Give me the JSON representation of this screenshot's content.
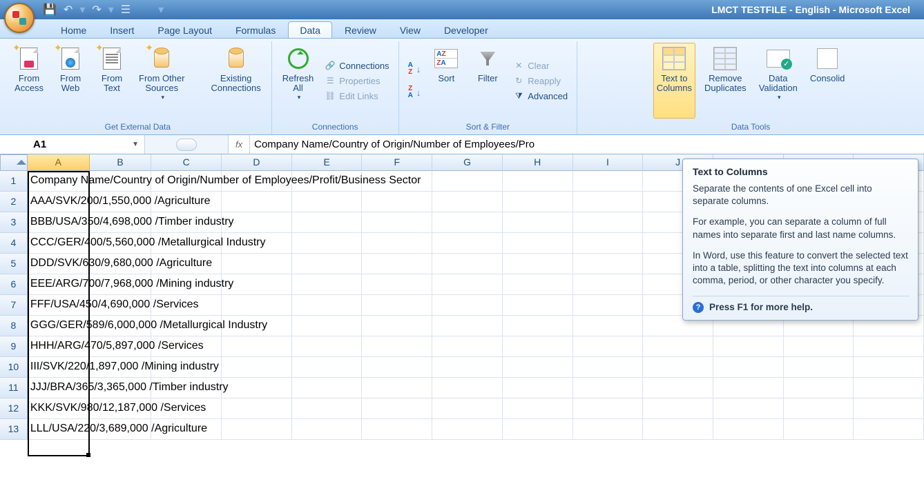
{
  "app_title": "LMCT TESTFILE - English - Microsoft Excel",
  "qat": {
    "save": "💾",
    "undo": "↶",
    "redo": "↷",
    "print": "☰"
  },
  "tabs": {
    "home": "Home",
    "insert": "Insert",
    "layout": "Page Layout",
    "formulas": "Formulas",
    "data": "Data",
    "review": "Review",
    "view": "View",
    "developer": "Developer"
  },
  "ribbon": {
    "ged": {
      "title": "Get External Data",
      "access": "From\nAccess",
      "web": "From\nWeb",
      "text": "From\nText",
      "other": "From Other\nSources",
      "existing": "Existing\nConnections"
    },
    "conn": {
      "title": "Connections",
      "refresh": "Refresh\nAll",
      "connections": "Connections",
      "properties": "Properties",
      "edit": "Edit Links"
    },
    "sf": {
      "title": "Sort & Filter",
      "sort": "Sort",
      "filter": "Filter",
      "clear": "Clear",
      "reapply": "Reapply",
      "advanced": "Advanced"
    },
    "dt": {
      "title": "Data Tools",
      "t2c": "Text to\nColumns",
      "dup": "Remove\nDuplicates",
      "dv": "Data\nValidation",
      "cons": "Consolid"
    }
  },
  "formula": {
    "name": "A1",
    "fx": "fx",
    "content": "Company Name/Country of Origin/Number of Employees/Pro"
  },
  "columns": [
    "A",
    "B",
    "C",
    "D",
    "E",
    "F",
    "G",
    "H",
    "I",
    "J",
    "K",
    "L",
    "M"
  ],
  "rows": [
    "Company Name/Country of Origin/Number of Employees/Profit/Business Sector",
    "AAA/SVK/200/1,550,000 /Agriculture",
    "BBB/USA/350/4,698,000 /Timber industry",
    "CCC/GER/400/5,560,000 /Metallurgical Industry",
    "DDD/SVK/630/9,680,000 /Agriculture",
    "EEE/ARG/700/7,968,000 /Mining industry",
    "FFF/USA/450/4,690,000 /Services",
    "GGG/GER/589/6,000,000 /Metallurgical Industry",
    "HHH/ARG/470/5,897,000 /Services",
    "III/SVK/220/1,897,000 /Mining industry",
    "JJJ/BRA/365/3,365,000 /Timber industry",
    "KKK/SVK/980/12,187,000 /Services",
    "LLL/USA/220/3,689,000 /Agriculture"
  ],
  "tooltip": {
    "title": "Text to Columns",
    "p1": "Separate the contents of one Excel cell into separate columns.",
    "p2": "For example, you can separate a column of full names into separate first and last name columns.",
    "p3": "In Word, use this feature to convert the selected text into a table, splitting the text into columns at each comma, period, or other character you specify.",
    "help": "Press F1 for more help."
  }
}
